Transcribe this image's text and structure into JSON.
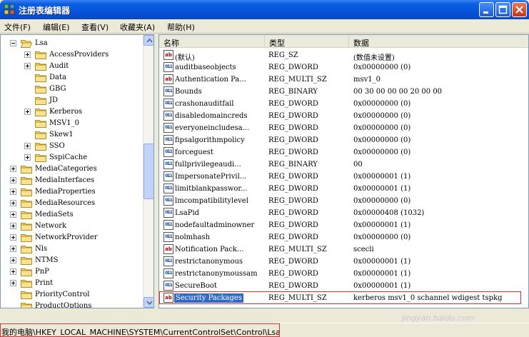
{
  "window": {
    "title": "注册表编辑器"
  },
  "menu": [
    "文件(F)",
    "编辑(E)",
    "查看(V)",
    "收藏夹(A)",
    "帮助(H)"
  ],
  "tree": {
    "items": [
      {
        "label": "Lsa",
        "expand": "minus",
        "open": true
      },
      {
        "label": "AccessProviders",
        "expand": "plus"
      },
      {
        "label": "Audit",
        "expand": "plus"
      },
      {
        "label": "Data",
        "expand": ""
      },
      {
        "label": "GBG",
        "expand": ""
      },
      {
        "label": "JD",
        "expand": ""
      },
      {
        "label": "Kerberos",
        "expand": "plus"
      },
      {
        "label": "MSV1_0",
        "expand": ""
      },
      {
        "label": "Skew1",
        "expand": ""
      },
      {
        "label": "SSO",
        "expand": "plus"
      },
      {
        "label": "SspiCache",
        "expand": "plus"
      },
      {
        "label": "MediaCategories",
        "expand": "plus"
      },
      {
        "label": "MediaInterfaces",
        "expand": "plus"
      },
      {
        "label": "MediaProperties",
        "expand": "plus"
      },
      {
        "label": "MediaResources",
        "expand": "plus"
      },
      {
        "label": "MediaSets",
        "expand": "plus"
      },
      {
        "label": "Network",
        "expand": "plus"
      },
      {
        "label": "NetworkProvider",
        "expand": "plus"
      },
      {
        "label": "Nls",
        "expand": "plus"
      },
      {
        "label": "NTMS",
        "expand": "plus"
      },
      {
        "label": "PnP",
        "expand": "plus"
      },
      {
        "label": "Print",
        "expand": "plus"
      },
      {
        "label": "PriorityControl",
        "expand": ""
      },
      {
        "label": "ProductOptions",
        "expand": ""
      }
    ]
  },
  "list": {
    "columns": [
      "名称",
      "类型",
      "数据"
    ],
    "rows": [
      {
        "name": "(默认)",
        "type": "REG_SZ",
        "data": "(数值未设置)",
        "icon": "ab"
      },
      {
        "name": "auditbaseobjects",
        "type": "REG_DWORD",
        "data": "0x00000000 (0)",
        "icon": "bin"
      },
      {
        "name": "Authentication Pa...",
        "type": "REG_MULTI_SZ",
        "data": "msv1_0",
        "icon": "ab"
      },
      {
        "name": "Bounds",
        "type": "REG_BINARY",
        "data": "00 30 00 00 00 20 00 00",
        "icon": "bin"
      },
      {
        "name": "crashonauditfail",
        "type": "REG_DWORD",
        "data": "0x00000000 (0)",
        "icon": "bin"
      },
      {
        "name": "disabledomaincreds",
        "type": "REG_DWORD",
        "data": "0x00000000 (0)",
        "icon": "bin"
      },
      {
        "name": "everyoneincludesa...",
        "type": "REG_DWORD",
        "data": "0x00000000 (0)",
        "icon": "bin"
      },
      {
        "name": "fipsalgorithmpolicy",
        "type": "REG_DWORD",
        "data": "0x00000000 (0)",
        "icon": "bin"
      },
      {
        "name": "forceguest",
        "type": "REG_DWORD",
        "data": "0x00000000 (0)",
        "icon": "bin"
      },
      {
        "name": "fullprivilegeaudi...",
        "type": "REG_BINARY",
        "data": "00",
        "icon": "bin"
      },
      {
        "name": "ImpersonatePrivil...",
        "type": "REG_DWORD",
        "data": "0x00000001 (1)",
        "icon": "bin"
      },
      {
        "name": "limitblankpasswor...",
        "type": "REG_DWORD",
        "data": "0x00000001 (1)",
        "icon": "bin"
      },
      {
        "name": "lmcompatibilitylevel",
        "type": "REG_DWORD",
        "data": "0x00000000 (0)",
        "icon": "bin"
      },
      {
        "name": "LsaPid",
        "type": "REG_DWORD",
        "data": "0x00000408 (1032)",
        "icon": "bin"
      },
      {
        "name": "nodefaultadminowner",
        "type": "REG_DWORD",
        "data": "0x00000001 (1)",
        "icon": "bin"
      },
      {
        "name": "nolmhash",
        "type": "REG_DWORD",
        "data": "0x00000000 (0)",
        "icon": "bin"
      },
      {
        "name": "Notification Pack...",
        "type": "REG_MULTI_SZ",
        "data": "scecli",
        "icon": "ab"
      },
      {
        "name": "restrictanonymous",
        "type": "REG_DWORD",
        "data": "0x00000001 (1)",
        "icon": "bin"
      },
      {
        "name": "restrictanonymoussam",
        "type": "REG_DWORD",
        "data": "0x00000001 (1)",
        "icon": "bin"
      },
      {
        "name": "SecureBoot",
        "type": "REG_DWORD",
        "data": "0x00000001 (1)",
        "icon": "bin"
      },
      {
        "name": "Security Packages",
        "type": "REG_MULTI_SZ",
        "data": "kerberos msv1_0 schannel wdigest tspkg",
        "icon": "ab",
        "selected": true
      }
    ]
  },
  "status": {
    "path": "我的电脑\\HKEY_LOCAL_MACHINE\\SYSTEM\\CurrentControlSet\\Control\\Lsa"
  },
  "watermark": "jingyan.baidu.com"
}
